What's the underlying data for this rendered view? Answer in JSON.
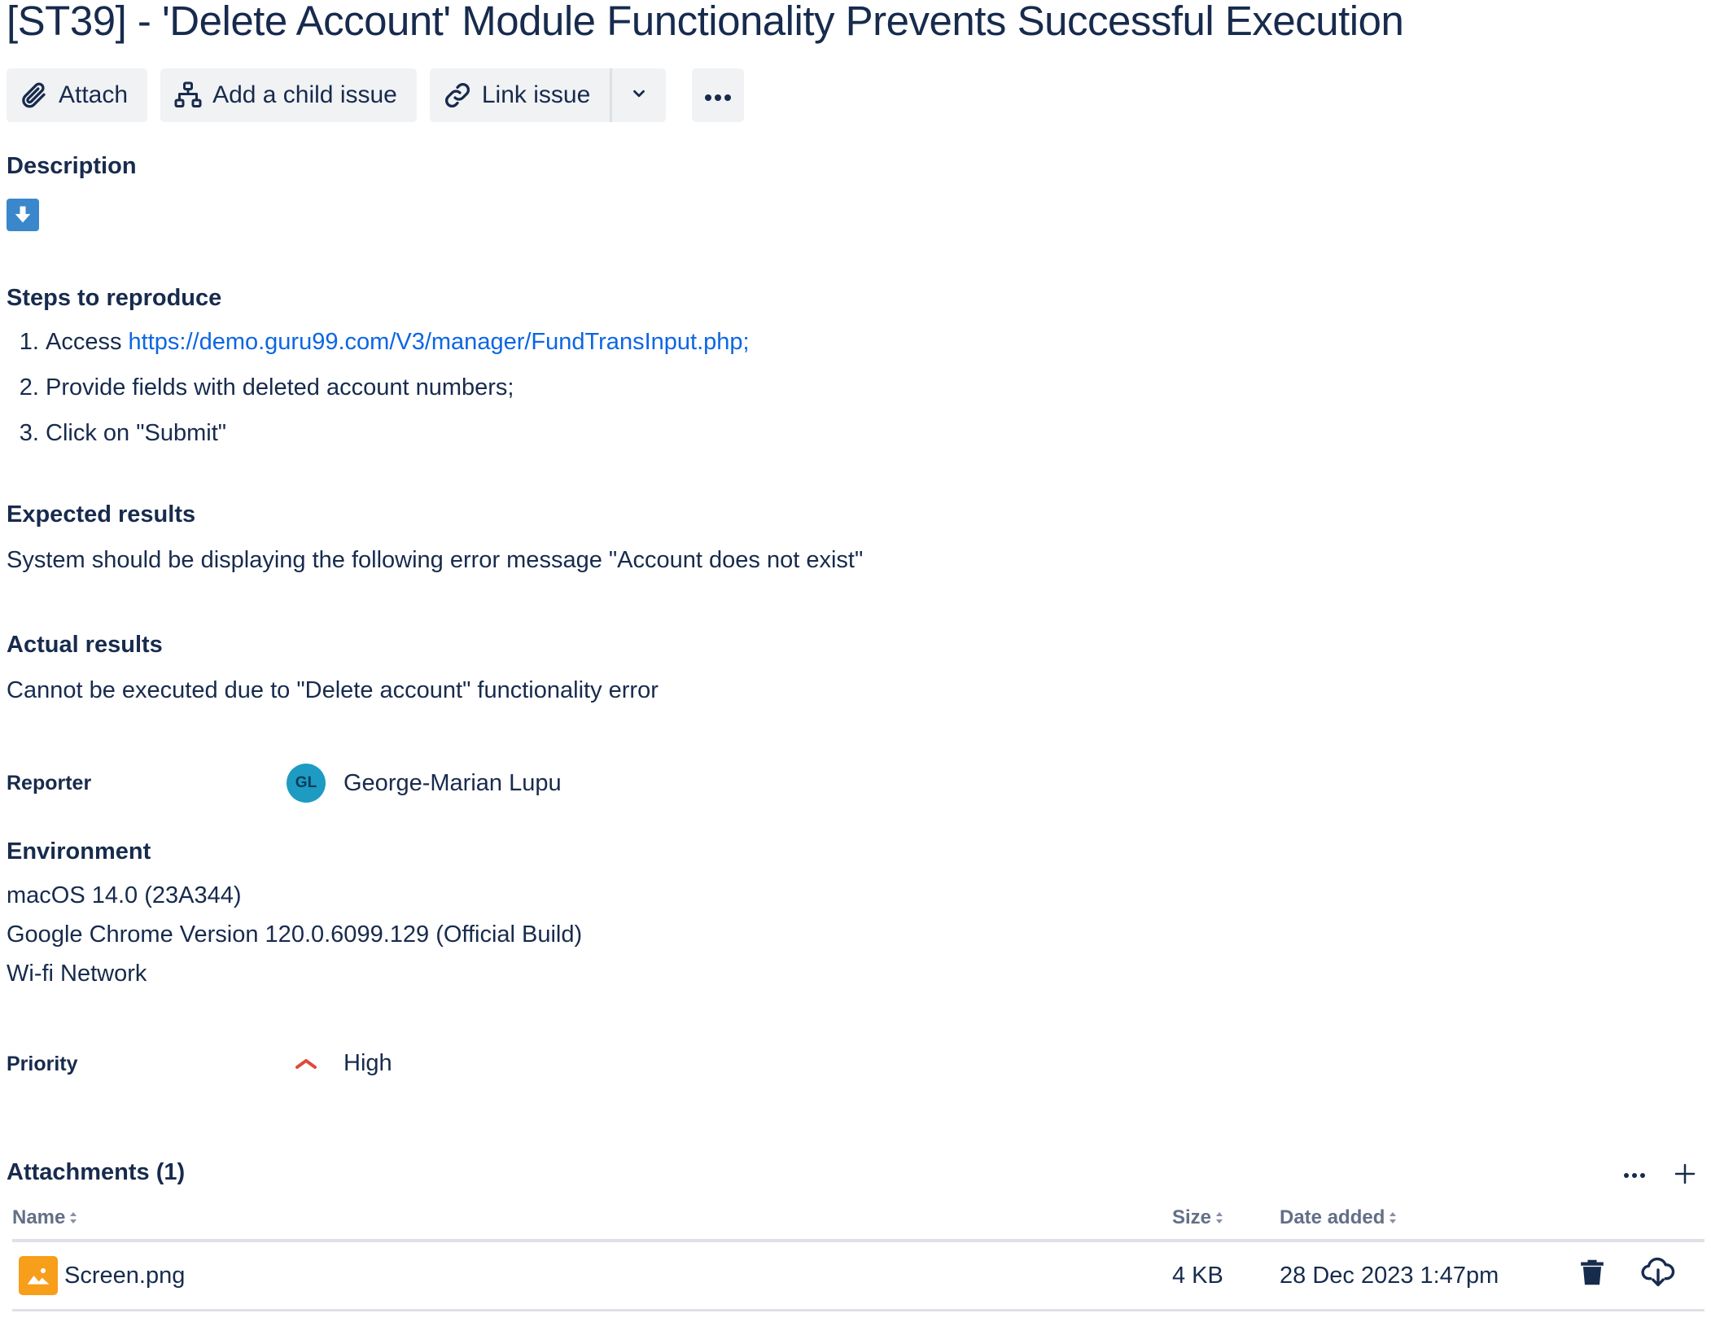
{
  "issue": {
    "title": "[ST39] - 'Delete Account' Module Functionality Prevents Successful Execution"
  },
  "toolbar": {
    "attach_label": "Attach",
    "child_issue_label": "Add a child issue",
    "link_issue_label": "Link issue"
  },
  "description": {
    "heading": "Description"
  },
  "steps": {
    "heading": "Steps to reproduce",
    "items": [
      {
        "prefix": "Access ",
        "link": "https://demo.guru99.com/V3/manager/FundTransInput.php;"
      },
      {
        "text": "Provide fields with deleted account numbers;"
      },
      {
        "text": "Click on \"Submit\""
      }
    ]
  },
  "expected": {
    "heading": "Expected results",
    "text": "System should be displaying the following error message \"Account does not exist\""
  },
  "actual": {
    "heading": "Actual results",
    "text": "Cannot be executed due to \"Delete account\" functionality error"
  },
  "reporter": {
    "label": "Reporter",
    "initials": "GL",
    "name": "George-Marian Lupu",
    "avatar_color": "#1d9bc3"
  },
  "environment": {
    "heading": "Environment",
    "lines": [
      "macOS 14.0 (23A344)",
      "Google Chrome Version 120.0.6099.129 (Official Build)",
      "Wi-fi Network"
    ]
  },
  "priority": {
    "label": "Priority",
    "value": "High",
    "icon": "priority-high-icon",
    "color": "#e2483d"
  },
  "attachments": {
    "heading": "Attachments (1)",
    "columns": {
      "name": "Name",
      "size": "Size",
      "date": "Date added"
    },
    "rows": [
      {
        "name": "Screen.png",
        "size": "4 KB",
        "date": "28 Dec 2023 1:47pm"
      }
    ]
  },
  "colors": {
    "text": "#172b4d",
    "link": "#0c66e4",
    "button_bg": "#f1f2f4",
    "info_icon_bg": "#3a87cc",
    "file_icon_bg": "#f79e1b"
  }
}
